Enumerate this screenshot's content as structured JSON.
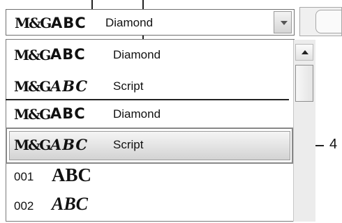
{
  "combo": {
    "monogram": "M&G",
    "sample": "ABC",
    "value": "Diamond"
  },
  "list": {
    "items": [
      {
        "monogram": "M&G",
        "sample": "ABC",
        "name": "Diamond"
      },
      {
        "monogram": "M&G",
        "sample": "ABC",
        "name": "Script"
      },
      {
        "monogram": "M&G",
        "sample": "ABC",
        "name": "Diamond"
      },
      {
        "monogram": "M&G",
        "sample": "ABC",
        "name": "Script"
      }
    ],
    "numbered": [
      {
        "number": "001",
        "sample": "ABC"
      },
      {
        "number": "002",
        "sample": "ABC"
      }
    ]
  },
  "callout": {
    "label": "4"
  },
  "icons": {
    "dropdown_arrow": "chevron-down-icon",
    "scroll_up": "arrow-up-icon"
  }
}
